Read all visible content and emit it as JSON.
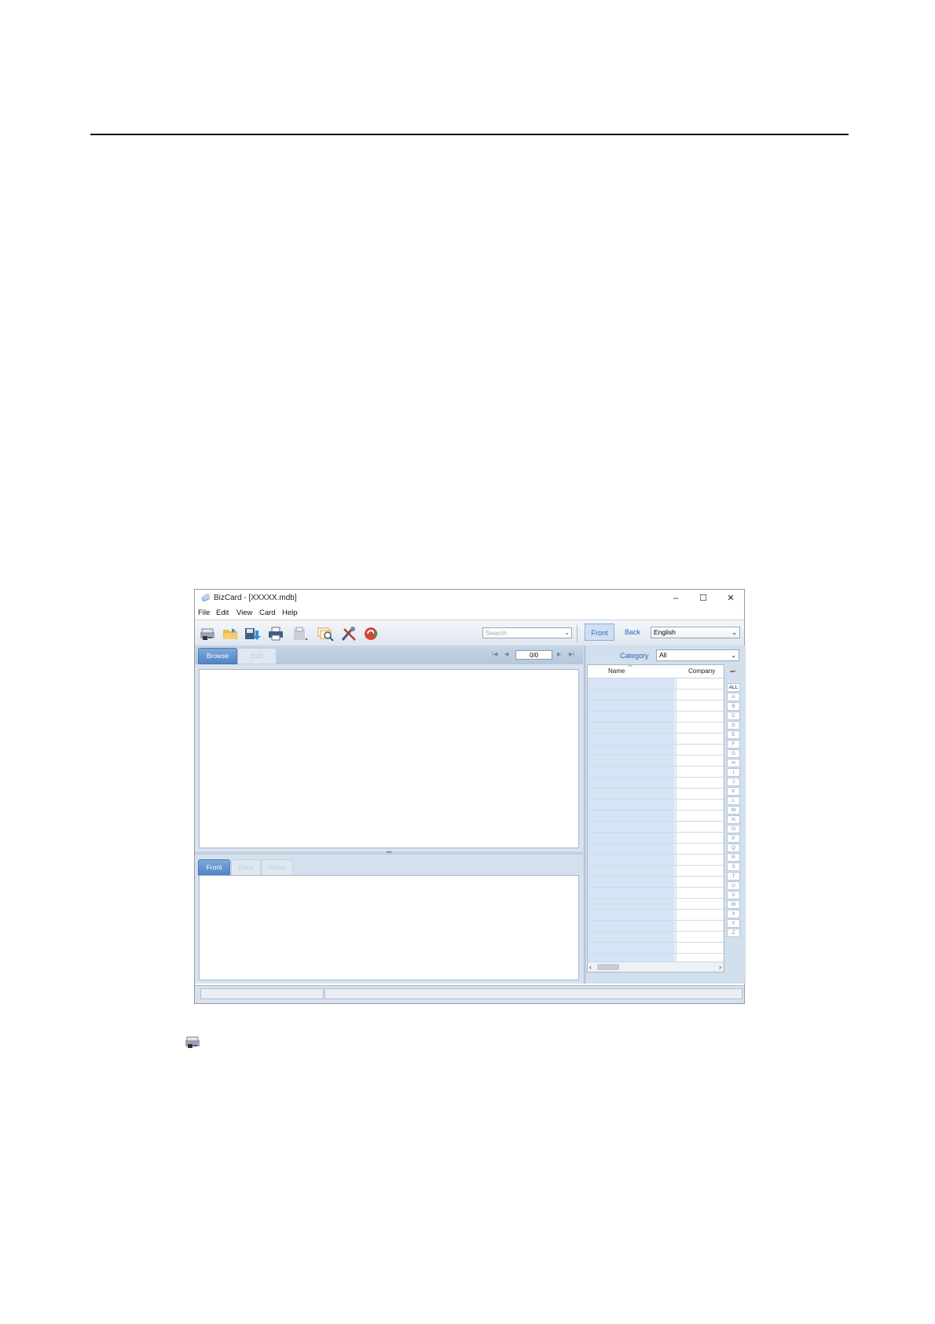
{
  "window": {
    "title": "BizCard - [XXXXX.mdb]",
    "controls": [
      "–",
      "☐",
      "✕"
    ]
  },
  "menu": [
    "File",
    "Edit",
    "View",
    "Card",
    "Help"
  ],
  "toolbar": {
    "icons": [
      "scan-icon",
      "open-folder-icon",
      "save-export-icon",
      "print-icon",
      "print-setup-icon",
      "find-duplicates-icon",
      "tools-icon",
      "sync-icon"
    ],
    "search_placeholder": "Search",
    "view_front": "Front",
    "view_back": "Back",
    "language": "English"
  },
  "browse": {
    "tab_browse": "Browse",
    "tab_edit": "Edit",
    "page_counter": "0/0",
    "nav": [
      "|◀",
      "◀",
      "▶",
      "▶|"
    ]
  },
  "card_tabs": [
    "Front",
    "Back",
    "Notes"
  ],
  "list": {
    "category_label": "Category",
    "category_value": "All",
    "col_name": "Name",
    "col_company": "Company",
    "alphabet": [
      "ALL",
      "A",
      "B",
      "C",
      "D",
      "E",
      "F",
      "G",
      "H",
      "I",
      "J",
      "K",
      "L",
      "M",
      "N",
      "O",
      "P",
      "Q",
      "R",
      "S",
      "T",
      "U",
      "V",
      "W",
      "X",
      "Y",
      "Z"
    ]
  },
  "colors": {
    "accent_blue": "#2a66b0",
    "pane_bg": "#d2dfed",
    "row_name_bg": "#d6e5f5"
  }
}
